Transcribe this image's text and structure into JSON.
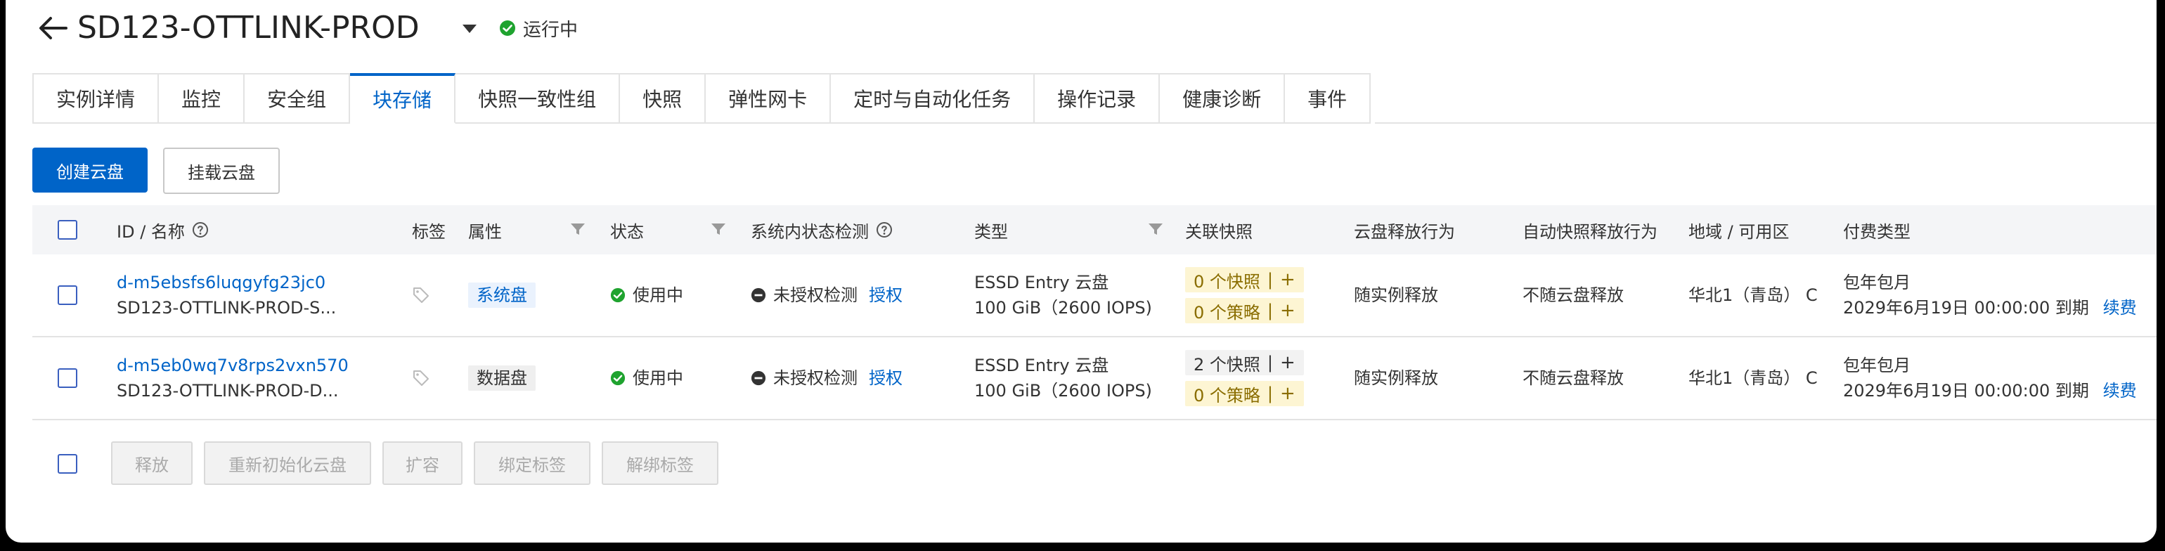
{
  "header": {
    "title": "SD123-OTTLINK-PROD",
    "status": "运行中"
  },
  "tabs": [
    {
      "label": "实例详情"
    },
    {
      "label": "监控"
    },
    {
      "label": "安全组"
    },
    {
      "label": "块存储",
      "active": true
    },
    {
      "label": "快照一致性组"
    },
    {
      "label": "快照"
    },
    {
      "label": "弹性网卡"
    },
    {
      "label": "定时与自动化任务"
    },
    {
      "label": "操作记录"
    },
    {
      "label": "健康诊断"
    },
    {
      "label": "事件"
    }
  ],
  "actions": {
    "create": "创建云盘",
    "attach": "挂载云盘"
  },
  "table": {
    "columns": {
      "id": "ID / 名称",
      "tag": "标签",
      "attr": "属性",
      "status": "状态",
      "check": "系统内状态检测",
      "type": "类型",
      "snapshot": "关联快照",
      "release": "云盘释放行为",
      "auto_release": "自动快照释放行为",
      "region": "地域 / 可用区",
      "billing": "付费类型"
    },
    "rows": [
      {
        "id": "d-m5ebsfs6luqgyfg23jc0",
        "name": "SD123-OTTLINK-PROD-S...",
        "attr": "系统盘",
        "status": "使用中",
        "check": "未授权检测",
        "auth": "授权",
        "type_line1": "ESSD Entry 云盘",
        "type_line2": "100 GiB（2600 IOPS)",
        "snap_count": "0 个快照",
        "policy_count": "0 个策略",
        "release": "随实例释放",
        "auto_release": "不随云盘释放",
        "region": "华北1（青岛） C",
        "billing_type": "包年包月",
        "expire": "2029年6月19日 00:00:00 到期",
        "renew": "续费"
      },
      {
        "id": "d-m5eb0wq7v8rps2vxn570",
        "name": "SD123-OTTLINK-PROD-D...",
        "attr": "数据盘",
        "status": "使用中",
        "check": "未授权检测",
        "auth": "授权",
        "type_line1": "ESSD Entry 云盘",
        "type_line2": "100 GiB（2600 IOPS)",
        "snap_count": "2 个快照",
        "policy_count": "0 个策略",
        "release": "随实例释放",
        "auto_release": "不随云盘释放",
        "region": "华北1（青岛） C",
        "billing_type": "包年包月",
        "expire": "2029年6月19日 00:00:00 到期",
        "renew": "续费"
      }
    ]
  },
  "bulk_actions": {
    "release": "释放",
    "reinit": "重新初始化云盘",
    "expand": "扩容",
    "bind_tag": "绑定标签",
    "unbind_tag": "解绑标签"
  },
  "separator": "|",
  "plus": "+",
  "colors": {
    "primary": "#0064c8",
    "success": "#1fa32f",
    "tab_active": "#0064c8",
    "snapshot_bg": "#fdf5d3"
  }
}
